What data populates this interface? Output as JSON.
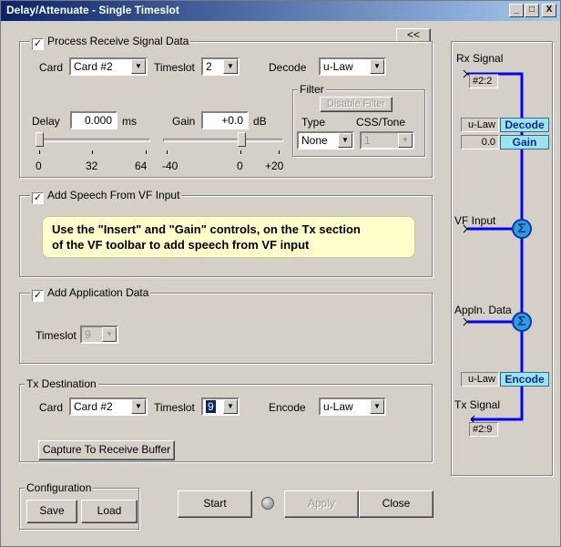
{
  "window": {
    "title": "Delay/Attenuate - Single Timeslot",
    "minimize": "_",
    "maximize": "□",
    "close": "X"
  },
  "collapse_button": "<<",
  "receive": {
    "checkbox_label": "Process Receive Signal Data",
    "checked": true,
    "card_label": "Card",
    "card_value": "Card #2",
    "timeslot_label": "Timeslot",
    "timeslot_value": "2",
    "decode_label": "Decode",
    "decode_value": "u-Law",
    "delay_label": "Delay",
    "delay_value": "0.000",
    "delay_unit": "ms",
    "gain_label": "Gain",
    "gain_value": "+0.0",
    "gain_unit": "dB",
    "delay_ticks": [
      "0",
      "32",
      "64"
    ],
    "gain_ticks": [
      "-40",
      "0",
      "+20"
    ],
    "delay_slider_fraction": 0.0,
    "gain_slider_fraction": 0.667,
    "filter": {
      "title": "Filter",
      "disable_button": "Disable Filter",
      "type_label": "Type",
      "type_value": "None",
      "css_label": "CSS/Tone",
      "css_value": "1"
    }
  },
  "speech": {
    "checkbox_label": "Add Speech From VF Input",
    "checked": true,
    "note_line1": "Use the \"Insert\" and \"Gain\" controls, on the Tx section",
    "note_line2": "of the VF toolbar to add speech from VF input"
  },
  "application": {
    "checkbox_label": "Add Application Data",
    "checked": true,
    "timeslot_label": "Timeslot",
    "timeslot_value": "9"
  },
  "tx": {
    "title": "Tx Destination",
    "card_label": "Card",
    "card_value": "Card #2",
    "timeslot_label": "Timeslot",
    "timeslot_value": "9",
    "encode_label": "Encode",
    "encode_value": "u-Law",
    "capture_button": "Capture To Receive Buffer"
  },
  "configuration": {
    "title": "Configuration",
    "save": "Save",
    "load": "Load"
  },
  "actions": {
    "start": "Start",
    "apply": "Apply",
    "close": "Close"
  },
  "flow": {
    "rx_signal": "Rx Signal",
    "rx_slot": "#2:2",
    "decode_law": "u-Law",
    "decode": "Decode",
    "gain_value": "0.0",
    "gain": "Gain",
    "vf_input": "VF Input",
    "sigma": "Σ",
    "appln_data": "Appln. Data",
    "encode_law": "u-Law",
    "encode": "Encode",
    "tx_signal": "Tx Signal",
    "tx_slot": "#2:9",
    "line_color": "#0000ff",
    "highlight_color": "#9ee3f0"
  }
}
